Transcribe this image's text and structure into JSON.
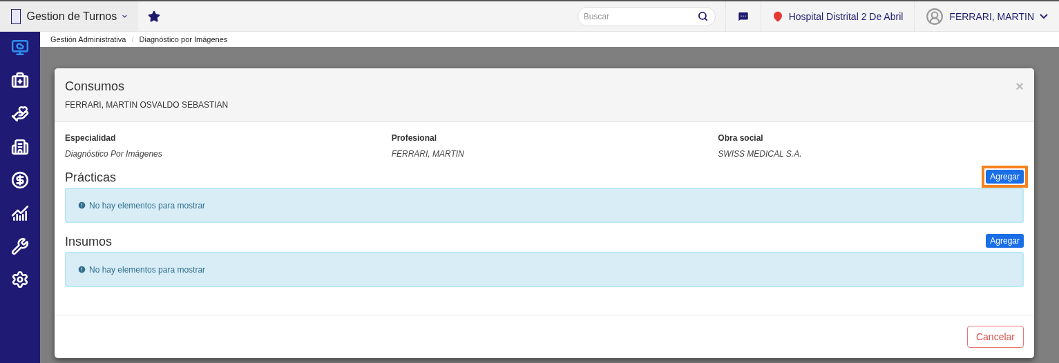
{
  "app": {
    "title": "Gestion de Turnos"
  },
  "search": {
    "placeholder": "Buscar"
  },
  "location": "Hospital Distrital 2 De Abril",
  "user": "FERRARI, MARTIN",
  "sidebar": {
    "items": [
      {
        "kind": "cloud",
        "selected": true
      },
      {
        "kind": "medkit",
        "selected": false
      },
      {
        "kind": "care",
        "selected": false
      },
      {
        "kind": "building",
        "selected": false
      },
      {
        "kind": "money",
        "selected": false
      },
      {
        "kind": "chart",
        "selected": false
      },
      {
        "kind": "tools",
        "selected": false
      },
      {
        "kind": "settings",
        "selected": false
      }
    ]
  },
  "breadcrumb": {
    "separator": "/",
    "items": [
      "Gestión Administrativa",
      "Diagnóstico por Imágenes"
    ]
  },
  "modal": {
    "title": "Consumos",
    "subtitle": "FERRARI, MARTIN OSVALDO SEBASTIAN",
    "close": "×",
    "fields": [
      {
        "label": "Especialidad",
        "value": "Diagnóstico Por Imágenes"
      },
      {
        "label": "Profesional",
        "value": "FERRARI, MARTIN"
      },
      {
        "label": "Obra social",
        "value": "SWISS MEDICAL S.A."
      }
    ],
    "sections": [
      {
        "title": "Prácticas",
        "button": "Agregar",
        "highlighted": true,
        "empty": "No hay elementos para mostrar"
      },
      {
        "title": "Insumos",
        "button": "Agregar",
        "highlighted": false,
        "empty": "No hay elementos para mostrar"
      }
    ],
    "cancel": "Cancelar"
  }
}
